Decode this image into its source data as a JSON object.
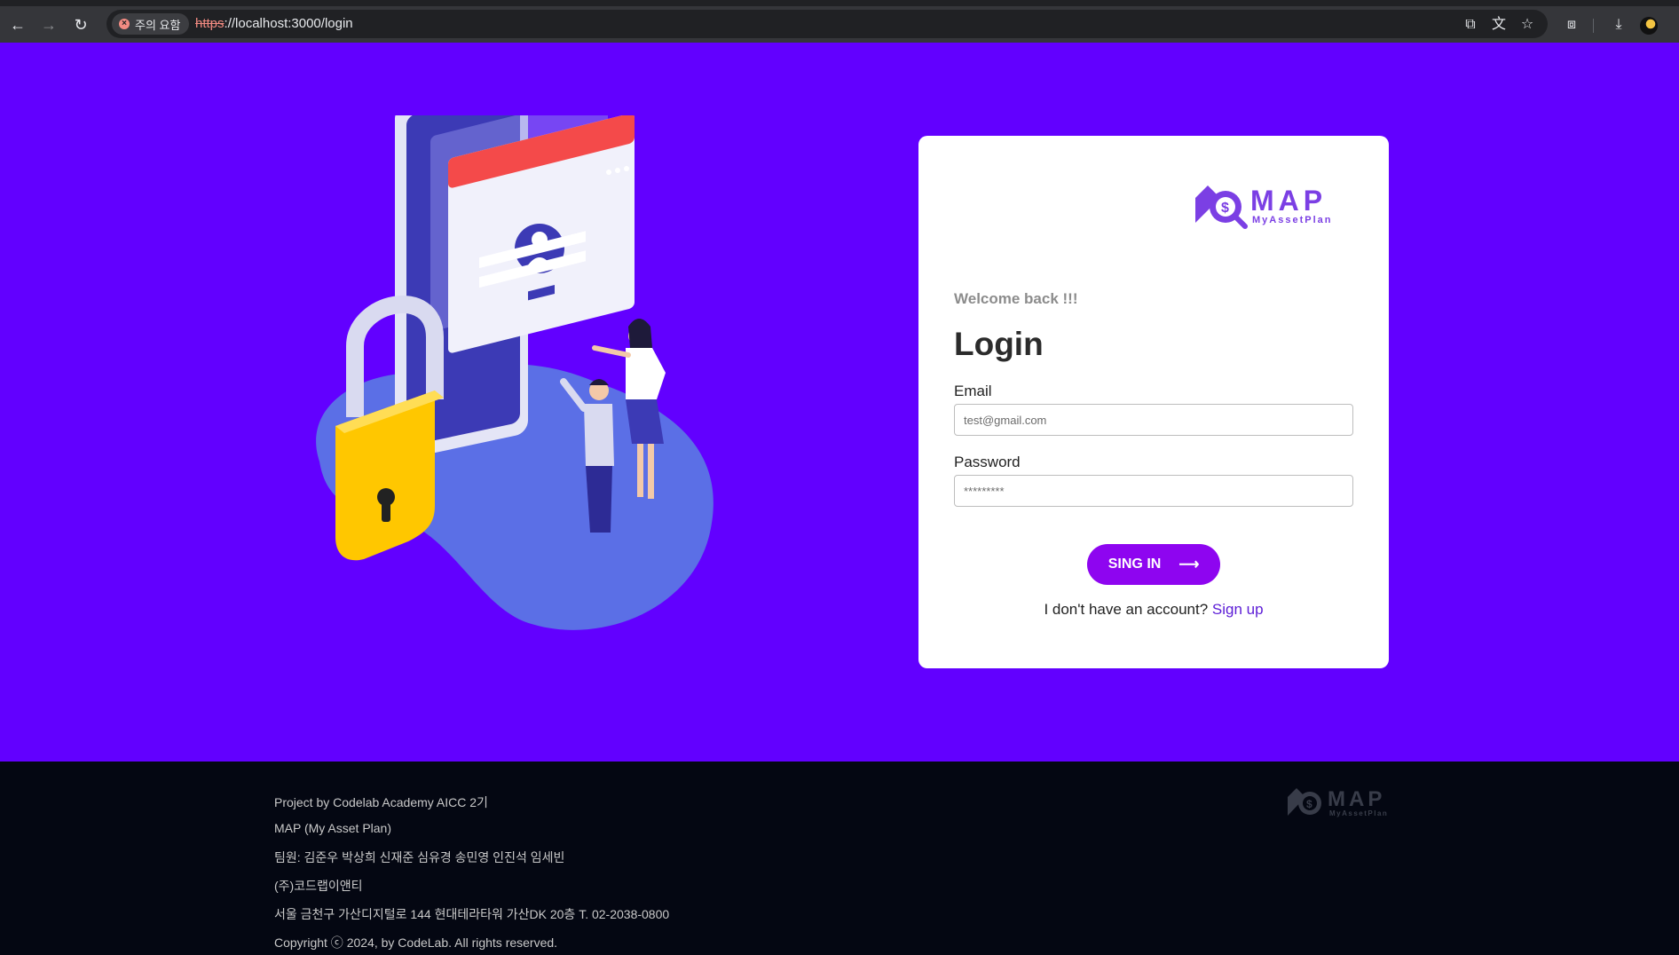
{
  "browser": {
    "security_chip": "주의 요함",
    "url_scheme": "https",
    "url_rest": "://localhost:3000/login",
    "icons": [
      "back-icon",
      "forward-icon",
      "reload-icon",
      "install-icon",
      "translate-icon",
      "star-icon",
      "extensions-icon",
      "download-icon",
      "profile-avatar"
    ]
  },
  "brand": {
    "logo_text": "MAP",
    "logo_subtext": "MyAssetPlan",
    "accent": "#6200ff",
    "button_color": "#8e05f0",
    "link_color": "#5b1bd6"
  },
  "login": {
    "welcome": "Welcome back !!!",
    "title": "Login",
    "email_label": "Email",
    "email_placeholder": "test@gmail.com",
    "password_label": "Password",
    "password_placeholder": "*********",
    "signin_label": "SING IN",
    "signin_icon": "arrow-right-icon",
    "no_account_text": "I don't have an account? ",
    "signup_link": "Sign up"
  },
  "footer": {
    "lines": [
      "Project by Codelab Academy AICC 2기",
      "MAP (My Asset Plan)",
      "팀원: 김준우 박상희 신재준 심유경 송민영 인진석 임세빈",
      "(주)코드랩이앤티",
      "서울 금천구 가산디지털로 144 현대테라타워 가산DK 20층 T. 02-2038-0800",
      "Copyright ⓒ 2024, by CodeLab. All rights reserved."
    ]
  }
}
